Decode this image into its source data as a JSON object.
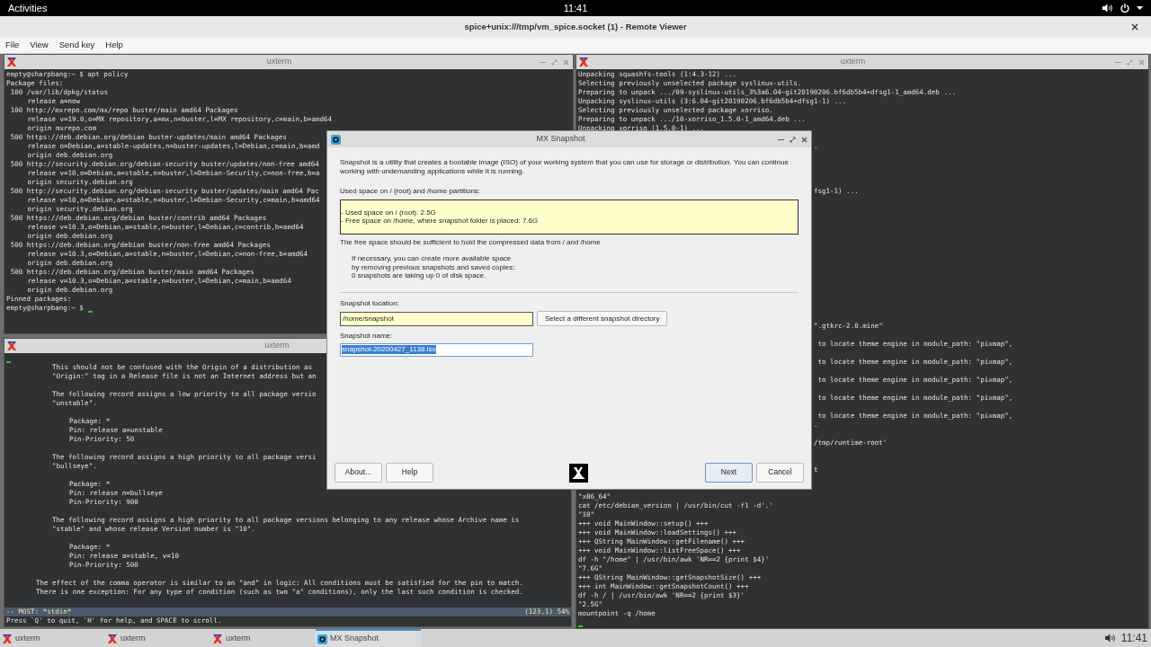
{
  "top_bar": {
    "activities": "Activities",
    "clock": "11:41"
  },
  "viewer": {
    "title": "spice+unix:///tmp/vm_spice.socket (1) - Remote Viewer",
    "menu": [
      "File",
      "View",
      "Send key",
      "Help"
    ]
  },
  "terminals": [
    {
      "title": "uxterm",
      "controls_visible": true,
      "lines": [
        {
          "kind": "plain",
          "text": "empty@sharpbang:~ $ apt policy"
        },
        {
          "kind": "plain",
          "text": "Package files:"
        },
        {
          "kind": "entry",
          "text": "100 /var/lib/dpkg/status"
        },
        {
          "kind": "detail",
          "text": "release a=now"
        },
        {
          "kind": "entry",
          "text": "100 http://mxrepo.com/mx/repo buster/main amd64 Packages"
        },
        {
          "kind": "detail",
          "text": "release v=19.0,o=MX repository,a=mx,n=buster,l=MX repository,c=main,b=amd64"
        },
        {
          "kind": "detail",
          "text": "origin mxrepo.com"
        },
        {
          "kind": "entry",
          "text": "500 https://deb.debian.org/debian buster-updates/main amd64 Packages"
        },
        {
          "kind": "detail",
          "text": "release o=Debian,a=stable-updates,n=buster-updates,l=Debian,c=main,b=amd"
        },
        {
          "kind": "detail",
          "text": "origin deb.debian.org"
        },
        {
          "kind": "entry",
          "text": "500 http://security.debian.org/debian-security buster/updates/non-free amd64"
        },
        {
          "kind": "detail",
          "text": "release v=10,o=Debian,a=stable,n=buster,l=Debian-Security,c=non-free,b=a"
        },
        {
          "kind": "detail",
          "text": "origin security.debian.org"
        },
        {
          "kind": "entry",
          "text": "500 http://security.debian.org/debian-security buster/updates/main amd64 Pac"
        },
        {
          "kind": "detail",
          "text": "release v=10,o=Debian,a=stable,n=buster,l=Debian-Security,c=main,b=amd64"
        },
        {
          "kind": "detail",
          "text": "origin security.debian.org"
        },
        {
          "kind": "entry",
          "text": "500 https://deb.debian.org/debian buster/contrib amd64 Packages"
        },
        {
          "kind": "detail",
          "text": "release v=10.3,o=Debian,a=stable,n=buster,l=Debian,c=contrib,b=amd64"
        },
        {
          "kind": "detail",
          "text": "origin deb.debian.org"
        },
        {
          "kind": "entry",
          "text": "500 https://deb.debian.org/debian buster/non-free amd64 Packages"
        },
        {
          "kind": "detail",
          "text": "release v=10.3,o=Debian,a=stable,n=buster,l=Debian,c=non-free,b=amd64"
        },
        {
          "kind": "detail",
          "text": "origin deb.debian.org"
        },
        {
          "kind": "entry",
          "text": "500 https://deb.debian.org/debian buster/main amd64 Packages"
        },
        {
          "kind": "detail",
          "text": "release v=10.3,o=Debian,a=stable,n=buster,l=Debian,c=main,b=amd64"
        },
        {
          "kind": "detail",
          "text": "origin deb.debian.org"
        },
        {
          "kind": "plain",
          "text": "Pinned packages:"
        },
        {
          "kind": "plain",
          "text": "empty@sharpbang:~ $",
          "cursor": true
        }
      ]
    },
    {
      "title": "uxterm",
      "controls_visible": false,
      "status": {
        "left": "-- MOST: *stdin*",
        "right": "(123,1) 54%"
      },
      "footer": "Press `Q' to quit, `H' for help, and SPACE to scroll.",
      "lines": [
        {
          "kind": "cursor"
        },
        {
          "kind": "example",
          "text": "This should not be confused with the Origin of a distribution as"
        },
        {
          "kind": "example",
          "text": "\"Origin:\" tag in a Release file is not an Internet address but an"
        },
        {
          "kind": "covered"
        },
        {
          "kind": "example",
          "text": "The following record assigns a low priority to all package versio"
        },
        {
          "kind": "example",
          "text": "\"unstable\"."
        },
        {
          "kind": "covered"
        },
        {
          "kind": "record",
          "text": "Package: *"
        },
        {
          "kind": "record",
          "text": "Pin: release a=unstable"
        },
        {
          "kind": "record",
          "text": "Pin-Priority: 50"
        },
        {
          "kind": "covered"
        },
        {
          "kind": "example",
          "text": "The following record assigns a high priority to all package versi"
        },
        {
          "kind": "example",
          "text": "\"bullseye\"."
        },
        {
          "kind": "covered"
        },
        {
          "kind": "record",
          "text": "Package: *"
        },
        {
          "kind": "record",
          "text": "Pin: release n=bullseye"
        },
        {
          "kind": "record",
          "text": "Pin-Priority: 900"
        },
        {
          "kind": "covered"
        },
        {
          "kind": "example",
          "text": "The following record assigns a high priority to all package versions belonging to any release whose Archive name is"
        },
        {
          "kind": "example",
          "text": "\"stable\" and whose release Version number is \"10\"."
        },
        {
          "kind": "covered"
        },
        {
          "kind": "record",
          "text": "Package: *"
        },
        {
          "kind": "record",
          "text": "Pin: release a=stable, v=10"
        },
        {
          "kind": "record",
          "text": "Pin-Priority: 500"
        },
        {
          "kind": "covered"
        },
        {
          "kind": "body",
          "text": "The effect of the comma operator is similar to an \"and\" in logic: All conditions must be satisfied for the pin to match."
        },
        {
          "kind": "body",
          "text": "There is one exception: For any type of condition (such as two \"a\" conditions), only the last such condition is checked."
        }
      ]
    },
    {
      "title": "uxterm",
      "controls_visible": true,
      "lines": [
        {
          "kind": "plain",
          "text": "Unpacking squashfs-tools (1:4.3-12) ..."
        },
        {
          "kind": "plain",
          "text": "Selecting previously unselected package syslinux-utils."
        },
        {
          "kind": "plain",
          "text": "Preparing to unpack .../09-syslinux-utils_3%3a6.04~git20190206.bf6db5b4+dfsg1-1_amd64.deb ..."
        },
        {
          "kind": "plain",
          "text": "Unpacking syslinux-utils (3:6.04~git20190206.bf6db5b4+dfsg1-1) ..."
        },
        {
          "kind": "plain",
          "text": "Selecting previously unselected package xorriso."
        },
        {
          "kind": "plain",
          "text": "Preparing to unpack .../10-xorriso_1.5.0-1_amd64.deb ..."
        },
        {
          "kind": "plain",
          "text": "Unpacking xorriso (1.5.0-1) ..."
        },
        {
          "kind": "covered"
        },
        {
          "kind": "tail",
          "text": "."
        },
        {
          "kind": "covered"
        },
        {
          "kind": "covered"
        },
        {
          "kind": "covered"
        },
        {
          "kind": "covered"
        },
        {
          "kind": "tail",
          "text": "fsg1-1) ..."
        },
        {
          "kind": "covered"
        },
        {
          "kind": "covered"
        },
        {
          "kind": "covered"
        },
        {
          "kind": "covered"
        },
        {
          "kind": "covered"
        },
        {
          "kind": "covered"
        },
        {
          "kind": "covered"
        },
        {
          "kind": "covered"
        },
        {
          "kind": "covered"
        },
        {
          "kind": "covered"
        },
        {
          "kind": "covered"
        },
        {
          "kind": "covered"
        },
        {
          "kind": "covered"
        },
        {
          "kind": "covered"
        },
        {
          "kind": "tail",
          "text": "\".gtkrc-2.0.mine\""
        },
        {
          "kind": "covered"
        },
        {
          "kind": "tail",
          "text": " to locate theme engine in module_path: \"pixmap\","
        },
        {
          "kind": "covered"
        },
        {
          "kind": "tail",
          "text": " to locate theme engine in module_path: \"pixmap\","
        },
        {
          "kind": "covered"
        },
        {
          "kind": "tail",
          "text": " to locate theme engine in module_path: \"pixmap\","
        },
        {
          "kind": "covered"
        },
        {
          "kind": "tail",
          "text": " to locate theme engine in module_path: \"pixmap\","
        },
        {
          "kind": "covered"
        },
        {
          "kind": "tail",
          "text": " to locate theme engine in module_path: \"pixmap\","
        },
        {
          "kind": "tail",
          "text": "."
        },
        {
          "kind": "covered"
        },
        {
          "kind": "tail",
          "text": "/tmp/runtime-root'"
        },
        {
          "kind": "covered"
        },
        {
          "kind": "covered"
        },
        {
          "kind": "tail",
          "text": "t"
        },
        {
          "kind": "covered"
        },
        {
          "kind": "covered"
        },
        {
          "kind": "plain",
          "text": "\"x86_64\""
        },
        {
          "kind": "plain",
          "text": "cat /etc/debian_version | /usr/bin/cut -f1 -d'.'"
        },
        {
          "kind": "plain",
          "text": "\"10\""
        },
        {
          "kind": "plain",
          "text": "+++ void MainWindow::setup() +++"
        },
        {
          "kind": "plain",
          "text": "+++ void MainWindow::loadSettings() +++"
        },
        {
          "kind": "plain",
          "text": "+++ QString MainWindow::getFilename() +++"
        },
        {
          "kind": "plain",
          "text": "+++ void MainWindow::listFreeSpace() +++"
        },
        {
          "kind": "plain",
          "text": "df -h \"/home\" | /usr/bin/awk 'NR==2 {print $4}'"
        },
        {
          "kind": "plain",
          "text": "\"7.6G\""
        },
        {
          "kind": "plain",
          "text": "+++ QString MainWindow::getSnapshotSize() +++"
        },
        {
          "kind": "plain",
          "text": "+++ int MainWindow::getSnapshotCount() +++"
        },
        {
          "kind": "plain",
          "text": "df -h / | /usr/bin/awk 'NR==2 {print $3}'"
        },
        {
          "kind": "plain",
          "text": "\"2.5G\""
        },
        {
          "kind": "plain",
          "text": "mountpoint -q /home"
        },
        {
          "kind": "cursor"
        }
      ]
    }
  ],
  "dialog": {
    "title": "MX Snapshot",
    "intro": "Snapshot is a utility that creates a bootable image (ISO) of your working system that you can use for storage or distribution. You can continue working with undemanding applications while it is running.",
    "used_label": "Used space on / (root) and /home partitions:",
    "usage_lines": [
      "- Used space on / (root): 2.5G",
      "- Free space on /home, where snapshot folder is placed: 7.6G"
    ],
    "sufficient_note": "The free space should be sufficient to hold the compressed data from / and /home",
    "hint_lines": [
      "If necessary, you can create more available space",
      "by removing previous snapshots and saved copies:",
      "0 snapshots are taking up 0 of disk space."
    ],
    "location_label": "Snapshot location:",
    "location_value": "/home/snapshot",
    "select_button": "Select a different snapshot directory",
    "name_label": "Snapshot name:",
    "name_value": "snapshot-20200427_1138.iso",
    "name_selected": true,
    "left_buttons": [
      {
        "label": "About...",
        "default": false
      },
      {
        "label": "Help",
        "default": false
      }
    ],
    "right_buttons": [
      {
        "label": "Next",
        "default": true
      },
      {
        "label": "Cancel",
        "default": false
      }
    ]
  },
  "taskbar": {
    "items": [
      {
        "label": "uxterm",
        "kind": "terminal",
        "selected": false
      },
      {
        "label": "uxterm",
        "kind": "terminal",
        "selected": false
      },
      {
        "label": "uxterm",
        "kind": "terminal",
        "selected": false
      },
      {
        "label": "MX Snapshot",
        "kind": "snapshot",
        "selected": true
      }
    ],
    "clock": "11:41"
  }
}
